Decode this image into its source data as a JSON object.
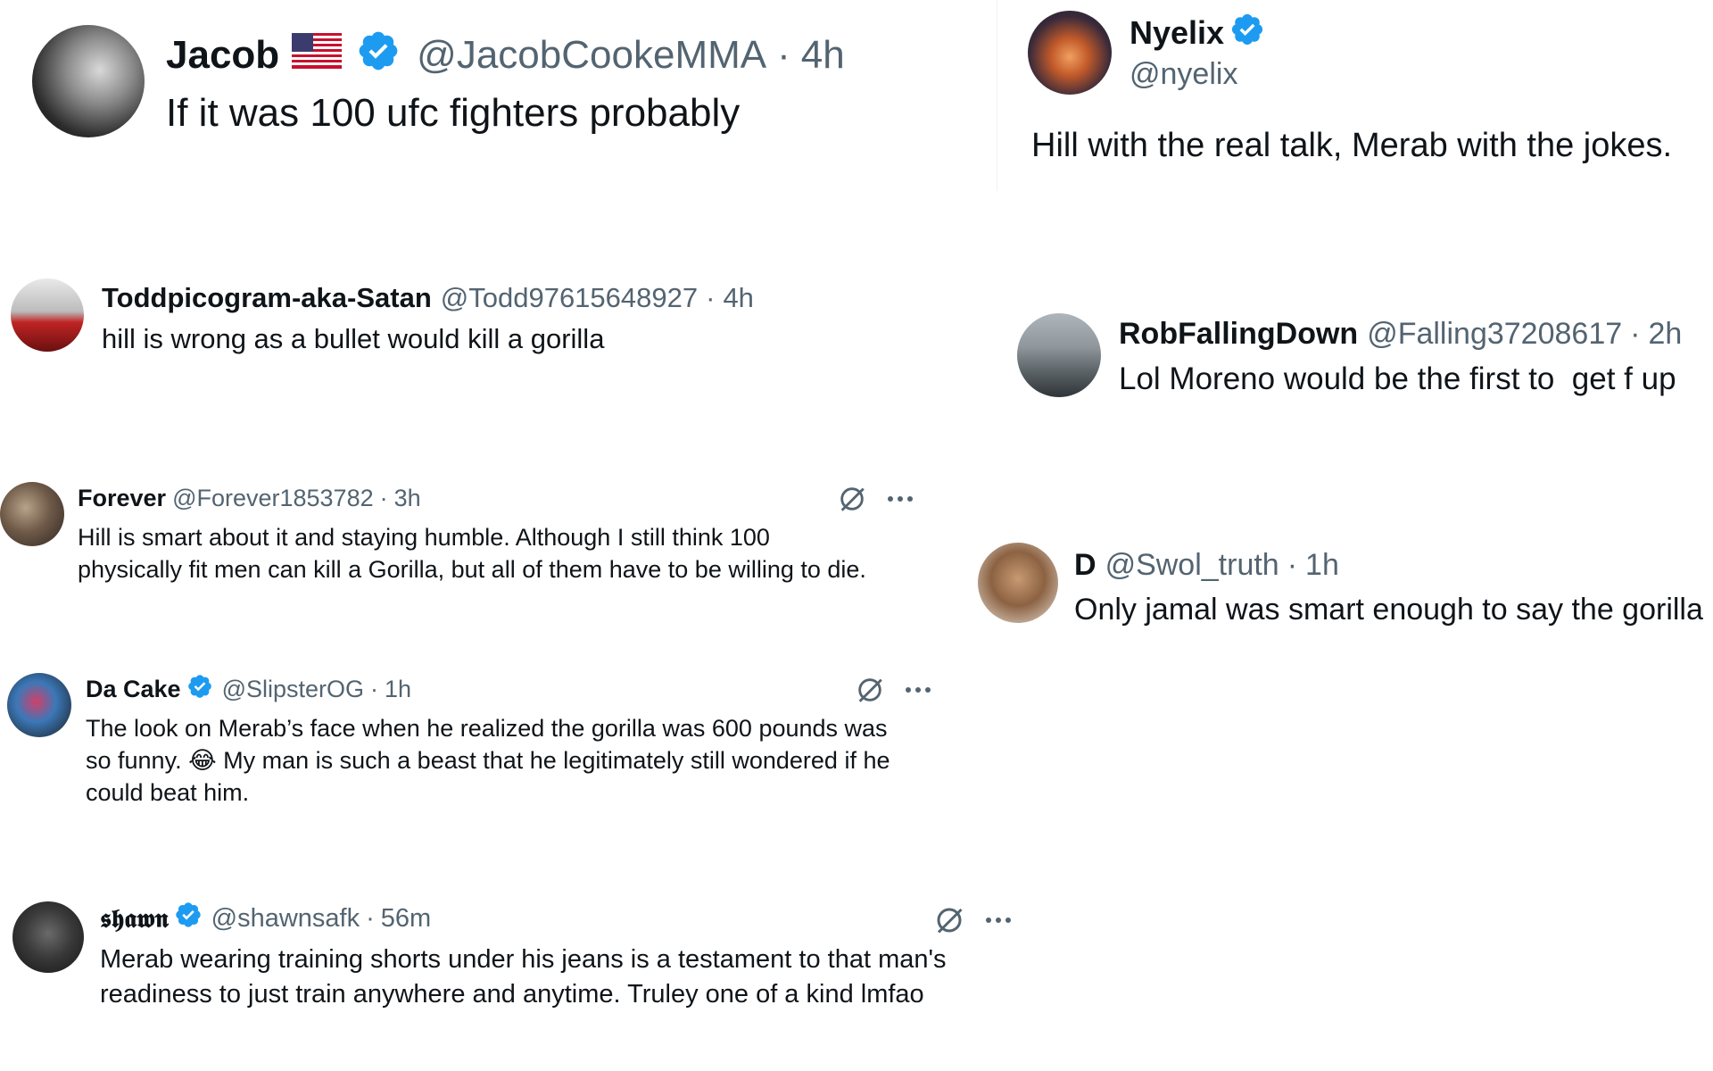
{
  "tweets": [
    {
      "name": "Jacob",
      "handle": "@JacobCookeMMA",
      "time": "4h",
      "text": "If it was 100 ufc fighters probably",
      "verified": true,
      "flag": "us-flag-icon"
    },
    {
      "name": "Nyelix",
      "handle": "@nyelix",
      "text": "Hill with the real talk, Merab with the jokes.",
      "verified": true
    },
    {
      "name": "Toddpicogram-aka-Satan",
      "handle": "@Todd97615648927",
      "time": "4h",
      "text": "hill is wrong as a bullet would kill a gorilla",
      "verified": false
    },
    {
      "name": "RobFallingDown",
      "handle": "@Falling37208617",
      "time": "2h",
      "text": "Lol Moreno would be the first to  get f up",
      "verified": false
    },
    {
      "name": "Forever",
      "handle": "@Forever1853782",
      "time": "3h",
      "text_line1": "Hill is smart about it and staying humble. Although I still think 100",
      "text_line2": "physically fit men can kill a Gorilla, but all of them have to be willing to die.",
      "verified": false
    },
    {
      "name": "D",
      "handle": "@Swol_truth",
      "time": "1h",
      "text": "Only jamal was smart enough to say the gorilla",
      "verified": false
    },
    {
      "name": "Da Cake",
      "handle": "@SlipsterOG",
      "time": "1h",
      "text_line1": "The look on Merab’s face when he realized the gorilla was 600 pounds was",
      "text_line2": "so funny. 😂 My man is such a beast that he legitimately still wondered if he",
      "text_line3": "could beat him.",
      "verified": true
    },
    {
      "name": "𝖘𝖍𝖆𝖜𝖓",
      "handle": "@shawnsafk",
      "time": "56m",
      "text_line1": "Merab wearing training shorts under his jeans is a testament to that man's",
      "text_line2": "readiness to just train anywhere and anytime. Truley one of a kind lmfao",
      "verified": true
    }
  ],
  "separator": "·",
  "more_label": "···",
  "colors": {
    "verified": "#1d9bf0",
    "secondary_text": "#536471",
    "primary_text": "#0f1419"
  }
}
